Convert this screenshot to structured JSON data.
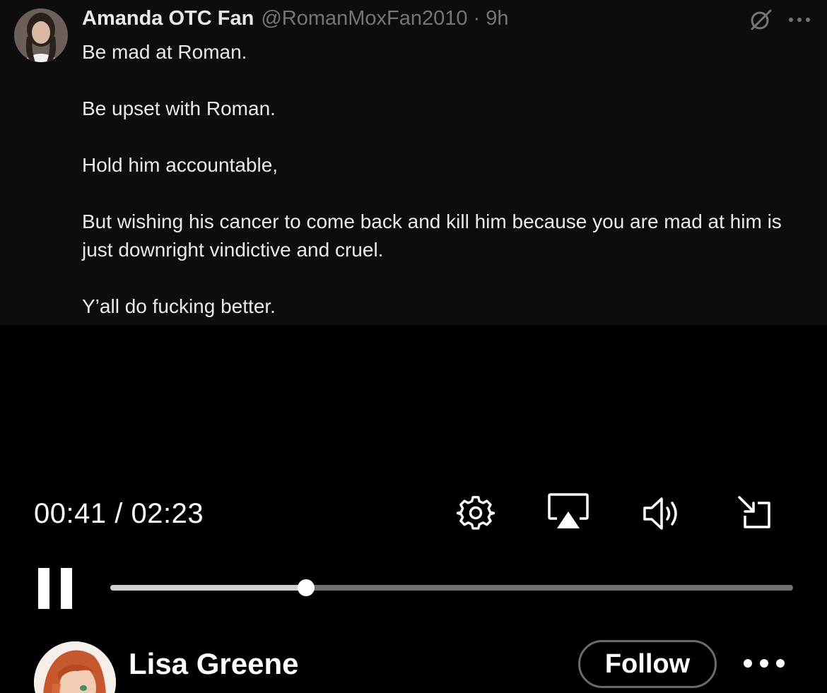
{
  "tweet": {
    "display_name": "Amanda OTC Fan",
    "handle": "@RomanMoxFan2010",
    "separator": "·",
    "time": "9h",
    "paragraphs": [
      "Be mad at Roman.",
      "Be upset with Roman.",
      "Hold him accountable,",
      "But wishing his cancer to come back and kill him because you are mad at him is just downright vindictive and cruel.",
      "Y’all do fucking better."
    ],
    "icons": {
      "grok": "grok-icon",
      "more": "more-horizontal-icon"
    }
  },
  "player": {
    "current_time": "00:41",
    "time_separator": "/",
    "duration": "02:23",
    "progress_fraction": 0.2867,
    "icons": {
      "settings": "gear-icon",
      "airplay": "airplay-icon",
      "volume": "volume-icon",
      "minimize": "minimize-icon",
      "pause": "pause-icon"
    },
    "colors": {
      "track": "#707070",
      "played": "#cfcfcf",
      "thumb": "#ffffff"
    }
  },
  "author": {
    "name": "Lisa Greene",
    "follow_label": "Follow",
    "icons": {
      "more": "more-horizontal-icon"
    }
  }
}
